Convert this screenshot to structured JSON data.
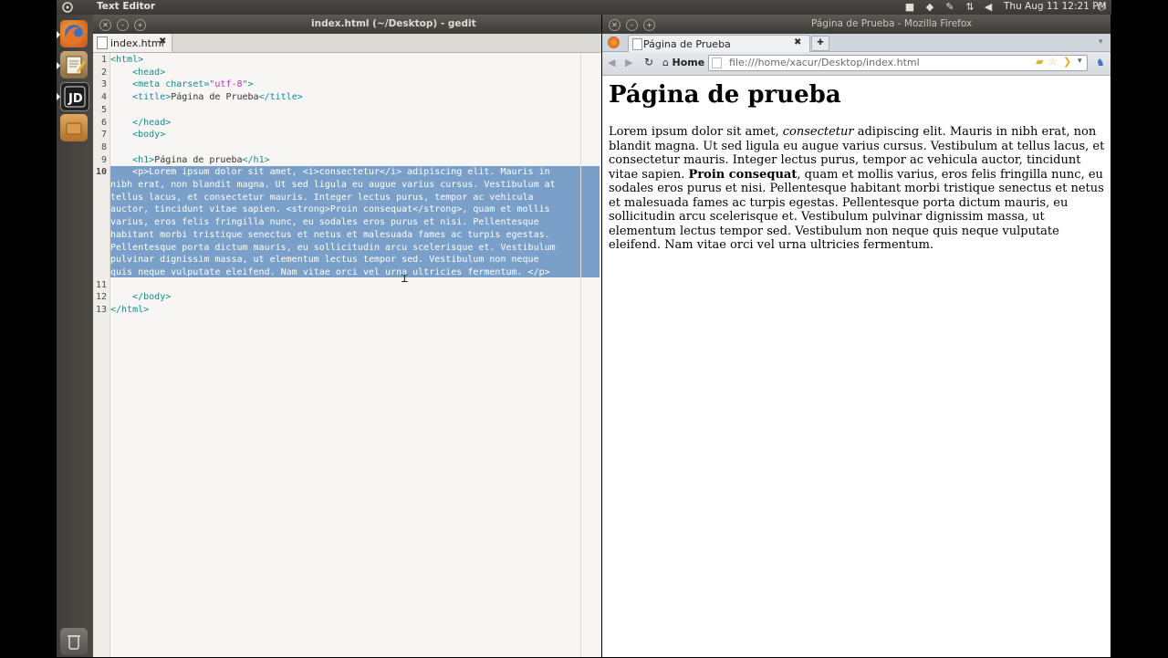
{
  "panel": {
    "app_title": "Text Editor",
    "clock": "Thu Aug 11 12:21 PM"
  },
  "gedit": {
    "window_title": "index.html (~/Desktop) - gedit",
    "tab_label": "index.html",
    "tab_close": "✖",
    "lines": [
      {
        "n": "1",
        "indent": "",
        "tag_open": "<html>",
        "text": ""
      },
      {
        "n": "2",
        "indent": "    ",
        "tag_open": "<head>",
        "text": ""
      },
      {
        "n": "3",
        "indent": "    ",
        "tag_open": "<meta ",
        "attr": "charset=",
        "str": "\"utf-8\"",
        "tag_close": ">"
      },
      {
        "n": "4",
        "indent": "    ",
        "tag_open": "<title>",
        "text": "Página de Prueba",
        "tag_end": "</title>"
      },
      {
        "n": "5",
        "indent": "",
        "tag_open": "",
        "text": ""
      },
      {
        "n": "6",
        "indent": "    ",
        "tag_open": "</head>",
        "text": ""
      },
      {
        "n": "7",
        "indent": "    ",
        "tag_open": "<body>",
        "text": ""
      },
      {
        "n": "8",
        "indent": "",
        "tag_open": "",
        "text": ""
      },
      {
        "n": "9",
        "indent": "    ",
        "tag_open": "<h1>",
        "text": "Página de prueba",
        "tag_end": "</h1>"
      },
      {
        "n": "10"
      },
      {
        "n": "11"
      },
      {
        "n": "12",
        "indent": "    ",
        "tag_open": "</body>",
        "text": ""
      },
      {
        "n": "13",
        "indent": "",
        "tag_open": "</html>",
        "text": ""
      }
    ],
    "selected_lines": [
      "    <p>Lorem ipsum dolor sit amet, <i>consectetur</i> adipiscing elit. Mauris in",
      "nibh erat, non blandit magna. Ut sed ligula eu augue varius cursus. Vestibulum at",
      "tellus lacus, et consectetur mauris. Integer lectus purus, tempor ac vehicula",
      "auctor, tincidunt vitae sapien. <strong>Proin consequat</strong>, quam et mollis",
      "varius, eros felis fringilla nunc, eu sodales eros purus et nisi. Pellentesque",
      "habitant morbi tristique senectus et netus et malesuada fames ac turpis egestas.",
      "Pellentesque porta dictum mauris, eu sollicitudin arcu scelerisque et. Vestibulum",
      "pulvinar dignissim massa, ut elementum lectus tempor sed. Vestibulum non neque",
      "quis neque vulputate eleifend. Nam vitae orci vel urna ultricies fermentum. </p>"
    ]
  },
  "firefox": {
    "window_title": "Página de Prueba - Mozilla Firefox",
    "tab_label": "Página de Prueba",
    "tab_close": "✖",
    "new_tab": "✚",
    "home_label": "Home",
    "url": "file:///home/xacur/Desktop/index.html",
    "page_heading": "Página de prueba",
    "page_paragraph": {
      "p1": "Lorem ipsum dolor sit amet, ",
      "italic": "consectetur",
      "p2": " adipiscing elit. Mauris in nibh erat, non blandit magna. Ut sed ligula eu augue varius cursus. Vestibulum at tellus lacus, et consectetur mauris. Integer lectus purus, tempor ac vehicula auctor, tincidunt vitae sapien. ",
      "bold": "Proin consequat",
      "p3": ", quam et mollis varius, eros felis fringilla nunc, eu sodales eros purus et nisi. Pellentesque habitant morbi tristique senectus et netus et malesuada fames ac turpis egestas. Pellentesque porta dictum mauris, eu sollicitudin arcu scelerisque et. Vestibulum pulvinar dignissim massa, ut elementum lectus tempor sed. Vestibulum non neque quis neque vulputate eleifend. Nam vitae orci vel urna ultricies fermentum."
    }
  },
  "icons": {
    "ubuntu": "ubuntu-logo-icon",
    "launcher": [
      "firefox-icon",
      "text-editor-icon",
      "dreamweaver-icon",
      "folder-icon",
      "trash-icon"
    ]
  },
  "colors": {
    "panel": "#3c3b37",
    "selection": "#7a9fc8",
    "html_tag": "#1a8a8a",
    "html_string": "#c02fc0"
  }
}
